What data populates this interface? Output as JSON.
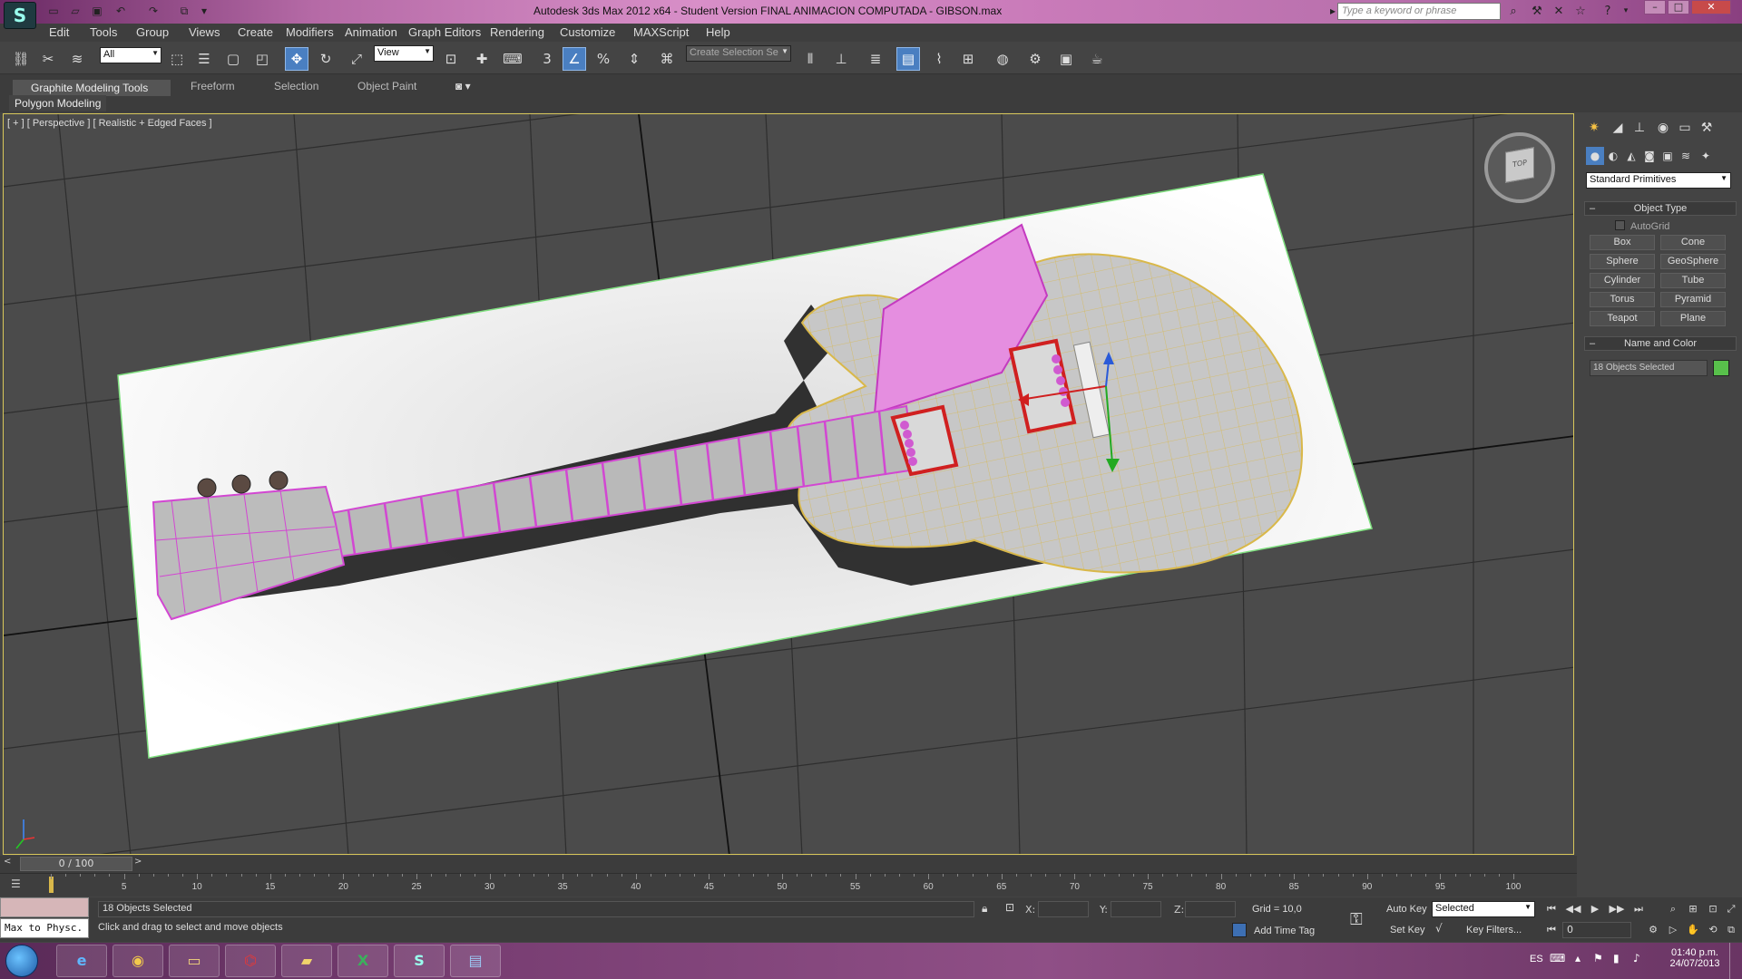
{
  "titlebar": {
    "title": "Autodesk 3ds Max  2012 x64  - Student Version    FINAL ANIMACION COMPUTADA - GIBSON.max",
    "search_placeholder": "Type a keyword or phrase",
    "accent": "#c97ab9"
  },
  "menu": [
    "Edit",
    "Tools",
    "Group",
    "Views",
    "Create",
    "Modifiers",
    "Animation",
    "Graph Editors",
    "Rendering",
    "Customize",
    "MAXScript",
    "Help"
  ],
  "toolbar": {
    "selection_filter": "All",
    "reference_coord": "View",
    "named_selection": "Create Selection Se"
  },
  "ribbon": {
    "tabs": [
      "Graphite Modeling Tools",
      "Freeform",
      "Selection",
      "Object Paint"
    ],
    "panel": "Polygon Modeling"
  },
  "viewport": {
    "label": "[ + ] [ Perspective ] [ Realistic + Edged Faces ]",
    "viewcube_label": "TOP"
  },
  "command_panel": {
    "category": "Standard Primitives",
    "object_type_title": "Object Type",
    "autogrid": "AutoGrid",
    "primitives": [
      "Box",
      "Cone",
      "Sphere",
      "GeoSphere",
      "Cylinder",
      "Tube",
      "Torus",
      "Pyramid",
      "Teapot",
      "Plane"
    ],
    "name_color_title": "Name and Color",
    "name_value": "18 Objects Selected",
    "object_color": "#58c04b"
  },
  "timeline": {
    "frame_display": "0 / 100",
    "ticks": [
      "5",
      "10",
      "15",
      "20",
      "25",
      "30",
      "35",
      "40",
      "45",
      "50",
      "55",
      "60",
      "65",
      "70",
      "75",
      "80",
      "85",
      "90",
      "95",
      "100"
    ]
  },
  "status": {
    "maxscript": "Max to Physc.",
    "selection": "18 Objects Selected",
    "prompt": "Click and drag to select and move objects",
    "x_label": "X:",
    "y_label": "Y:",
    "z_label": "Z:",
    "grid": "Grid = 10,0",
    "add_time_tag": "Add Time Tag",
    "auto_key": "Auto Key",
    "set_key": "Set Key",
    "key_mode": "Selected",
    "key_filters": "Key Filters...",
    "current_frame": "0"
  },
  "taskbar": {
    "lang": "ES",
    "time": "01:40 p.m.",
    "date": "24/07/2013"
  }
}
